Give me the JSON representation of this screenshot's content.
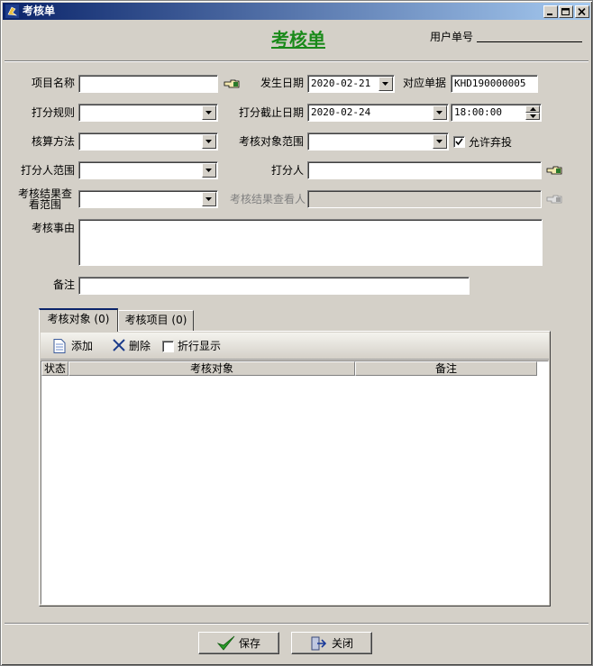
{
  "window": {
    "title": "考核单",
    "icon": "app-logo-icon"
  },
  "header": {
    "form_title": "考核单",
    "user_no_label": "用户单号"
  },
  "form": {
    "project_name": {
      "label": "项目名称",
      "value": ""
    },
    "occur_date": {
      "label": "发生日期",
      "value": "2020-02-21"
    },
    "ref_doc": {
      "label": "对应单据",
      "value": "KHD190000005"
    },
    "score_rule": {
      "label": "打分规则",
      "value": ""
    },
    "score_deadline": {
      "label": "打分截止日期",
      "date": "2020-02-24",
      "time": "18:00:00"
    },
    "calc_method": {
      "label": "核算方法",
      "value": ""
    },
    "target_scope": {
      "label": "考核对象范围",
      "value": ""
    },
    "allow_abstain": {
      "label": "允许弃投",
      "checked": true
    },
    "scorer_scope": {
      "label": "打分人范围",
      "value": ""
    },
    "scorer": {
      "label": "打分人",
      "value": ""
    },
    "result_view_scope": {
      "label": "考核结果查看范围",
      "value": ""
    },
    "result_viewer": {
      "label": "考核结果查看人",
      "value": ""
    },
    "reason": {
      "label": "考核事由",
      "value": ""
    },
    "remark": {
      "label": "备注",
      "value": ""
    }
  },
  "tabs": [
    {
      "label": "考核对象 (0)",
      "active": true
    },
    {
      "label": "考核项目 (0)",
      "active": false
    }
  ],
  "toolbar": {
    "add_label": "添加",
    "delete_label": "删除",
    "wrap_label": "折行显示",
    "wrap_checked": false
  },
  "grid": {
    "columns": [
      "状态",
      "考核对象",
      "备注"
    ],
    "rows": []
  },
  "footer": {
    "save_label": "保存",
    "close_label": "关闭"
  },
  "colors": {
    "title_green": "#1a8a1a",
    "titlebar_start": "#0a246a",
    "face": "#d4d0c8"
  }
}
